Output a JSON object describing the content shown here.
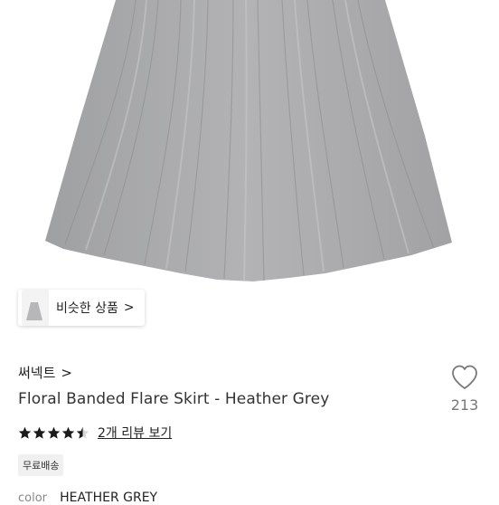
{
  "similar": {
    "label": "비슷한 상품",
    "chevron": ">"
  },
  "brand": {
    "name": "써넥트",
    "chevron": ">"
  },
  "product": {
    "name": "Floral Banded Flare Skirt - Heather Grey"
  },
  "like": {
    "icon": "heart-outline-icon",
    "count": "213"
  },
  "rating": {
    "value": 4.5,
    "max": 5,
    "review_link": "2개 리뷰 보기",
    "star_color": "#1a1a1a"
  },
  "badges": {
    "free_shipping": "무료배송"
  },
  "options": {
    "color_label": "color",
    "color_value": "HEATHER GREY"
  },
  "colors": {
    "skirt": "#a9a9ab",
    "text": "#222222",
    "muted": "#777777"
  }
}
